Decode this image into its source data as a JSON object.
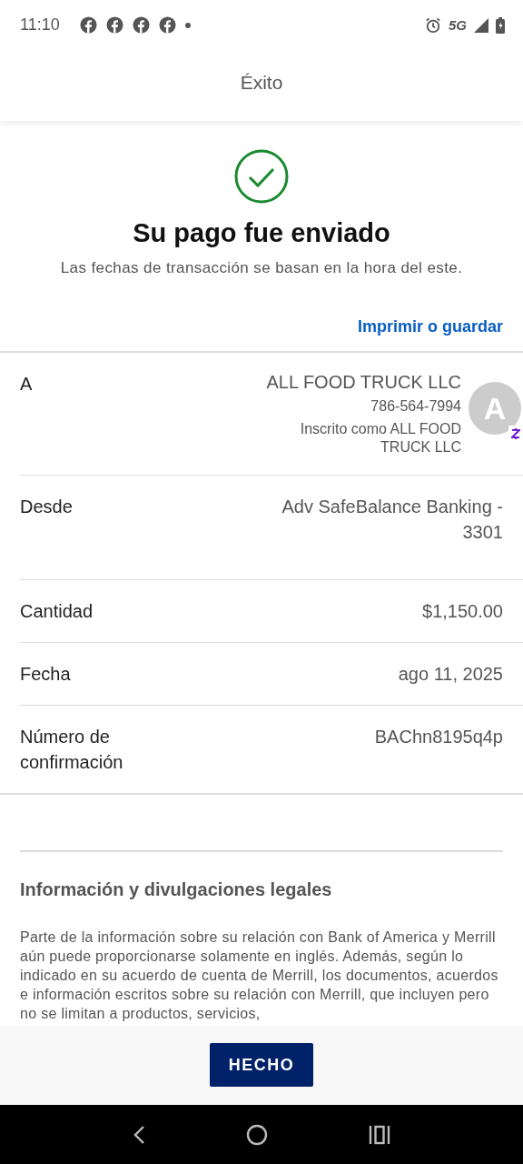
{
  "status_bar": {
    "time": "11:10",
    "network": "5G"
  },
  "header": {
    "title": "Éxito"
  },
  "success": {
    "title": "Su pago fue enviado",
    "subtitle": "Las fechas de transacción se basan en la hora del este."
  },
  "print_link": "Imprimir o guardar",
  "details": [
    {
      "kind": "recipient",
      "label": "A",
      "name": "ALL FOOD TRUCK LLC",
      "phone": "786-564-7994",
      "note": "Inscrito como ALL FOOD TRUCK LLC",
      "avatar": "A"
    },
    {
      "kind": "plain",
      "label": "Desde",
      "value": "Adv SafeBalance Banking - 3301"
    },
    {
      "kind": "plain",
      "label": "Cantidad",
      "value": "$1,150.00"
    },
    {
      "kind": "plain",
      "label": "Fecha",
      "value": "ago 11, 2025"
    },
    {
      "kind": "plain",
      "label": "Número de confirmación",
      "value": "BAChn8195q4p"
    }
  ],
  "legal": {
    "title": "Información y divulgaciones legales",
    "text": "Parte de la información sobre su relación con Bank of America y Merrill aún puede proporcionarse solamente en inglés. Además, según lo indicado en su acuerdo de cuenta de Merrill, los documentos, acuerdos e información escritos sobre su relación con Merrill, que incluyen pero no se limitan a productos, servicios,"
  },
  "button": "HECHO"
}
